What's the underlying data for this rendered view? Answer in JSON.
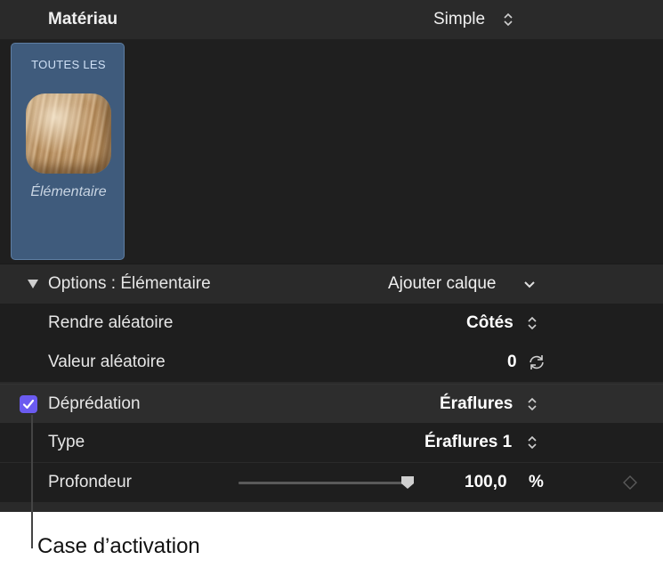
{
  "header": {
    "label": "Matériau",
    "value": "Simple"
  },
  "browser": {
    "tile_header": "TOUTES LES",
    "tile_name": "Élémentaire"
  },
  "options": {
    "label": "Options : Élémentaire",
    "action": "Ajouter calque"
  },
  "rows": {
    "randomize": {
      "label": "Rendre aléatoire",
      "value": "Côtés"
    },
    "random_value": {
      "label": "Valeur aléatoire",
      "value": "0"
    },
    "wear": {
      "label": "Déprédation",
      "value": "Éraflures",
      "checked": true
    },
    "type": {
      "label": "Type",
      "value": "Éraflures 1"
    },
    "depth": {
      "label": "Profondeur",
      "value": "100,0",
      "unit": "%",
      "slider_fraction": 1.0
    }
  },
  "callout": {
    "text": "Case d’activation"
  },
  "colors": {
    "accent": "#6b5bf0",
    "tile": "#3f5b7c",
    "panel": "#2a2a2a"
  }
}
